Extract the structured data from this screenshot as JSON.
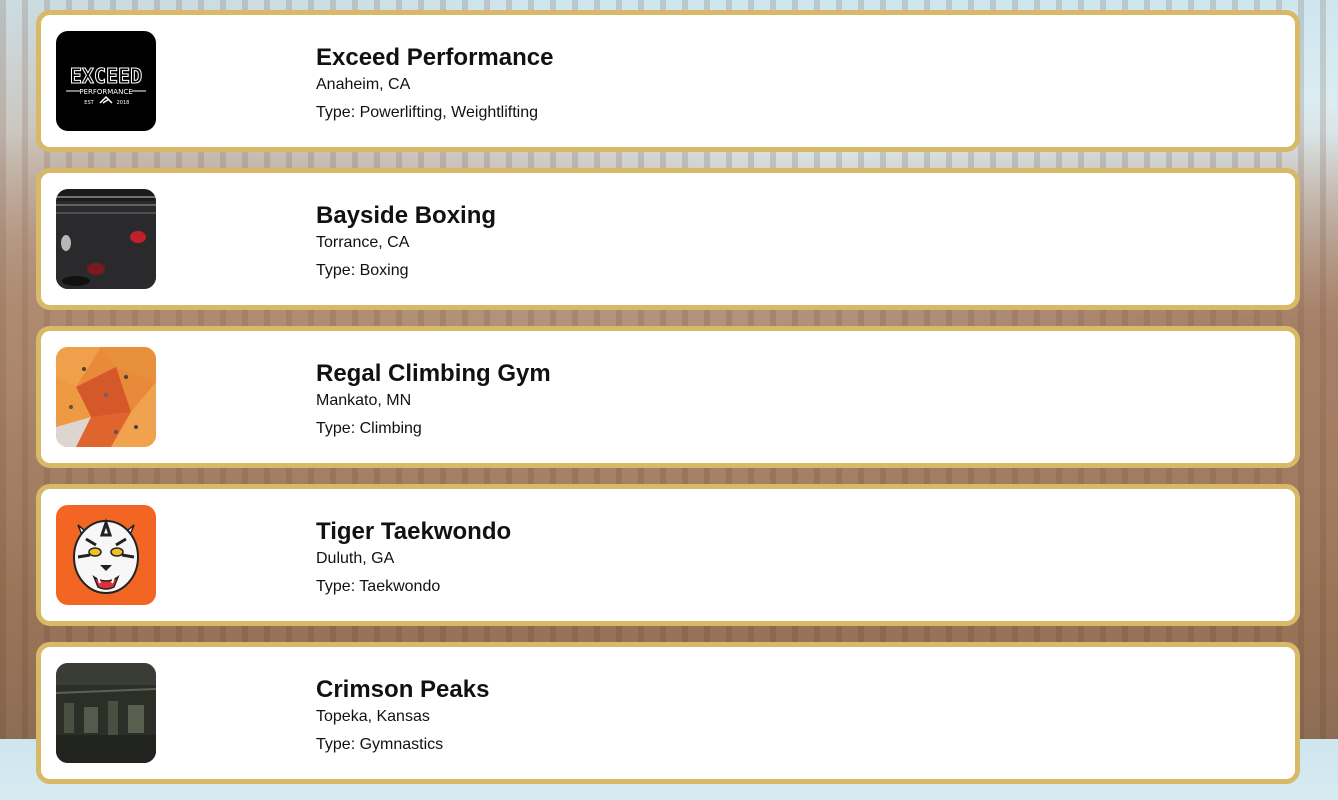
{
  "gyms": [
    {
      "name": "Exceed Performance",
      "location": "Anaheim, CA",
      "type": "Type: Powerlifting, Weightlifting",
      "image": "exceed-logo",
      "logo": {
        "title": "EXCEED",
        "subtitle": "PERFORMANCE",
        "left": "EST",
        "right": "2018"
      }
    },
    {
      "name": "Bayside Boxing",
      "location": "Torrance, CA",
      "type": "Type: Boxing",
      "image": "boxing-ring-photo"
    },
    {
      "name": "Regal Climbing Gym",
      "location": "Mankato, MN",
      "type": "Type: Climbing",
      "image": "climbing-wall-photo"
    },
    {
      "name": "Tiger Taekwondo",
      "location": "Duluth, GA",
      "type": "Type: Taekwondo",
      "image": "tiger-logo"
    },
    {
      "name": "Crimson Peaks",
      "location": "Topeka, Kansas",
      "type": "Type: Gymnastics",
      "image": "gym-interior-photo"
    }
  ],
  "colors": {
    "card_border": "#d8b967",
    "card_bg": "#ffffff",
    "text": "#111111",
    "tiger_bg": "#f26522"
  }
}
